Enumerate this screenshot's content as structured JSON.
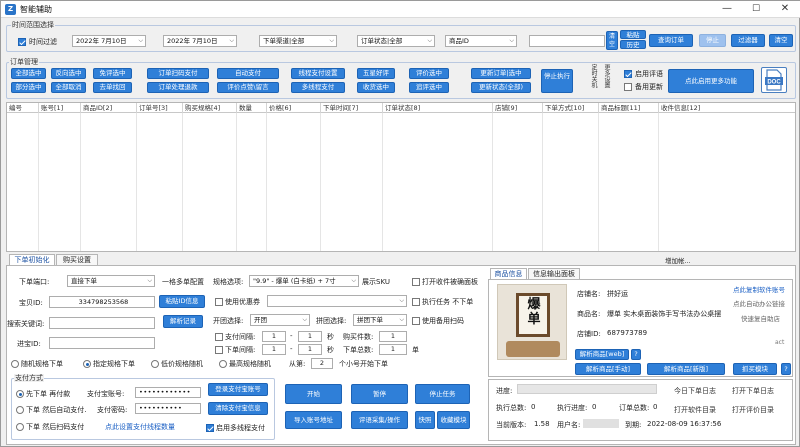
{
  "window": {
    "title": "智能辅助",
    "min": "—",
    "max": "☐",
    "close": "✕"
  },
  "time_range": {
    "legend": "时间范围选择",
    "filter_label": "时间过滤",
    "filter_checked": true,
    "start_date": "2022年 7月10日",
    "end_date": "2022年 7月10日",
    "channel": "下单渠道|全部",
    "status": "订单状态|全部",
    "product_id_combo": "商品ID",
    "search_value": "",
    "btn_clear": "清空",
    "btn_paste": "粘贴",
    "btn_history": "历史",
    "btn_query": "查询订单",
    "btn_stop": "停止",
    "btn_filter": "过滤器",
    "btn_clear2": "清空"
  },
  "order_mgmt": {
    "legend": "订单管理",
    "row1": [
      "全部选中",
      "反向选中",
      "免评选中",
      "订单扫码支付",
      "自动支付",
      "线程支付设置",
      "五星好评",
      "评价选中",
      "更新订单|选中"
    ],
    "row2": [
      "部分选中",
      "全部取消",
      "去单找回",
      "订单处理退款",
      "评价点赞\\留言",
      "多线程支付",
      "收货选中",
      "追评选中",
      "更新状态(全部)"
    ],
    "btn_stop_exec": "停止执行",
    "vlabel1": "定时关机",
    "vlabel2": "更多设置",
    "use_eval_label": "启用评语",
    "use_eval_checked": true,
    "backup_update_label": "备用更新",
    "backup_update_checked": false,
    "btn_more": "点此启用更多功能",
    "doc_label": "DOC"
  },
  "grid": {
    "columns": [
      "编号",
      "账号[1]",
      "商品ID[2]",
      "订单号[3]",
      "购买规格[4]",
      "数量",
      "价格[6]",
      "下单时间[7]",
      "订单状态[8]",
      "店铺[9]",
      "下单方式[10]",
      "商品标题[11]",
      "收件信息[12]"
    ]
  },
  "bottom_tabs": {
    "tab1": "下单初始化",
    "tab2": "购买设置"
  },
  "status_line": "增加帐...",
  "order_init": {
    "port_label": "下单端口:",
    "port_value": "直接下单",
    "multi_acct_label": "一格多单配置",
    "buyer_id_label": "宝贝ID:",
    "buyer_id_value": "334798253568",
    "btn_paste_id": "粘贴ID信息",
    "keyword_label": "搜索关键词:",
    "keyword_value": "",
    "btn_parse_record": "解析记录",
    "store_label": "进宝ID:",
    "store_value": "",
    "spec_label": "规格选项:",
    "spec_value": "\"9.9\" - 爆单 (白卡纸) + 7寸",
    "display_sku_label": "展示SKU",
    "open_browser_label": "打开收件被确面板",
    "open_browser_checked": false,
    "use_coupon_label": "使用优惠券",
    "use_coupon_checked": false,
    "coupon_value": "",
    "exec_task_label": "执行任务 不下单",
    "exec_task_checked": false,
    "group_select_label": "开团选择:",
    "group_select_value": "开团",
    "pin_select_label": "拼团选择:",
    "pin_select_value": "拼团下单",
    "use_backup_label": "使用备用扫码",
    "use_backup_checked": false,
    "pay_interval_label": "支付间隔:",
    "pay_interval_from": "1",
    "pay_interval_to": "1",
    "sec1": "秒",
    "order_interval_label": "下单间隔:",
    "order_interval_from": "1",
    "order_interval_to": "1",
    "sec2": "秒",
    "buy_count_label": "购买件数:",
    "buy_count_value": "1",
    "order_total_label": "下单总数:",
    "order_total_value": "1",
    "unit": "单",
    "radio_random": "随机规格下单",
    "radio_specified": "指定规格下单",
    "radio_low_random": "低价规格随机",
    "radio_high_random": "最高规格随机",
    "from_label": "从第:",
    "from_value": "2",
    "from_suffix": "个小号开始下单",
    "pay_legend": "支付方式",
    "pay_radio1": "先下单 再付款",
    "pay_radio2": "下单 然后自动支付.",
    "pay_radio3": "下单 然后扫码支付",
    "alipay_acct_label": "支付宝账号:",
    "alipay_acct_value": "••••••••••••",
    "pay_pwd_label": "支付密码:",
    "pay_pwd_value": "••••••••••",
    "pay_link": "点此设置支付线程数量",
    "btn_login_alipay": "登录支付宝账号",
    "btn_clear_alipay": "清除支付宝信息",
    "multi_thread_label": "启用多线程支付",
    "multi_thread_checked": true,
    "btn_start": "开始",
    "btn_pause": "暂停",
    "btn_stop_task": "停止任务",
    "btn_import": "导入账号地址",
    "btn_eval": "评语采集/操作",
    "btn_quick": "快照",
    "btn_collect": "收藏模块"
  },
  "product_panel": {
    "tab1": "商品信息",
    "tab2": "信息输出面板",
    "shop_name_label": "店铺名:",
    "shop_name_value": "拼好运",
    "product_name_label": "商品名:",
    "product_name_value": "爆单 实木桌面装饰手写书法办公桌摆",
    "store_id_label": "店铺ID:",
    "store_id_value": "687973789",
    "link_copy": "点此复制软件账号",
    "link_auto_copy": "点此自动办公链接",
    "link_quick_store": "快速复自助店",
    "act_text": "act",
    "btn_parse_web": "解析商品[web]",
    "btn_q1": "?",
    "btn_parse_manual": "解析商品[手动]",
    "btn_parse_new": "解析商品[新版]",
    "btn_capture": "抓买模块",
    "btn_q2": "?",
    "img_text": "爆单"
  },
  "info_panel": {
    "progress_label": "进度:",
    "exec_total_label": "执行总数:",
    "exec_total_value": "0",
    "exec_progress_label": "执行进度:",
    "exec_progress_value": "0",
    "order_total_label": "订单总数:",
    "order_total_value": "0",
    "version_label": "当前版本:",
    "version_value": "1.58",
    "user_label": "用户名:",
    "expire_label": "到期:",
    "expire_value": "2022-08-09 16:37:56",
    "link_today_log": "今日下单日志",
    "link_open_log": "打开下单日志",
    "link_open_dir": "打开软件目录",
    "link_open_eval": "打开评价目录"
  }
}
